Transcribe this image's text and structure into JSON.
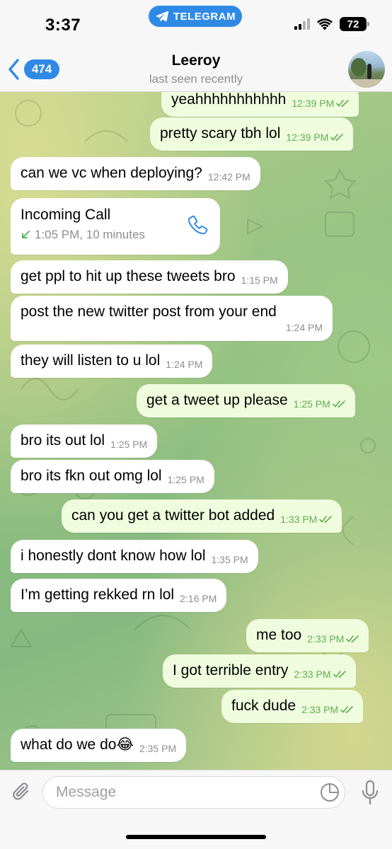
{
  "status_bar": {
    "time": "3:37",
    "app_pill": "TELEGRAM",
    "battery": "72"
  },
  "header": {
    "back_count": "474",
    "contact_name": "Leeroy",
    "last_seen": "last seen recently"
  },
  "messages": [
    {
      "dir": "out",
      "text": "yeahhhhhhhhhhh",
      "time": "12:39 PM"
    },
    {
      "dir": "out",
      "text": "pretty scary tbh lol",
      "time": "12:39 PM"
    },
    {
      "dir": "in",
      "text": "can we vc when deploying?",
      "time": "12:42 PM"
    },
    {
      "dir": "in",
      "text": "get ppl to hit up these tweets bro",
      "time": "1:15 PM"
    },
    {
      "dir": "in",
      "text": "post the new twitter post from your end",
      "time": "1:24 PM"
    },
    {
      "dir": "in",
      "text": "they will listen to u lol",
      "time": "1:24 PM"
    },
    {
      "dir": "out",
      "text": "get a tweet up please",
      "time": "1:25 PM"
    },
    {
      "dir": "in",
      "text": "bro its out lol",
      "time": "1:25 PM"
    },
    {
      "dir": "in",
      "text": "bro its fkn out omg lol",
      "time": "1:25 PM"
    },
    {
      "dir": "out",
      "text": "can you get a twitter bot added",
      "time": "1:33 PM"
    },
    {
      "dir": "in",
      "text": "i honestly dont know how lol",
      "time": "1:35 PM"
    },
    {
      "dir": "in",
      "text": "I’m getting rekked rn lol",
      "time": "2:16 PM"
    },
    {
      "dir": "out",
      "text": "me too",
      "time": "2:33 PM"
    },
    {
      "dir": "out",
      "text": "I got terrible entry",
      "time": "2:33 PM"
    },
    {
      "dir": "out",
      "text": "fuck dude",
      "time": "2:33 PM"
    },
    {
      "dir": "in",
      "text": "what do we do😂",
      "time": "2:35 PM"
    }
  ],
  "call": {
    "title": "Incoming Call",
    "detail": "1:05 PM, 10 minutes"
  },
  "input": {
    "placeholder": "Message"
  },
  "icons": {
    "telegram": "telegram-logo-icon",
    "back": "chevron-left-icon",
    "phone": "phone-icon",
    "incoming": "arrow-down-left-icon",
    "attach": "paperclip-icon",
    "sticker": "sticker-icon",
    "mic": "microphone-icon",
    "read": "double-check-icon"
  },
  "colors": {
    "accent": "#2f8ae6",
    "outgoing_bubble": "#effdde",
    "incoming_bubble": "#ffffff",
    "read_tick": "#5fae4f",
    "incoming_call_arrow": "#4cae4f"
  }
}
